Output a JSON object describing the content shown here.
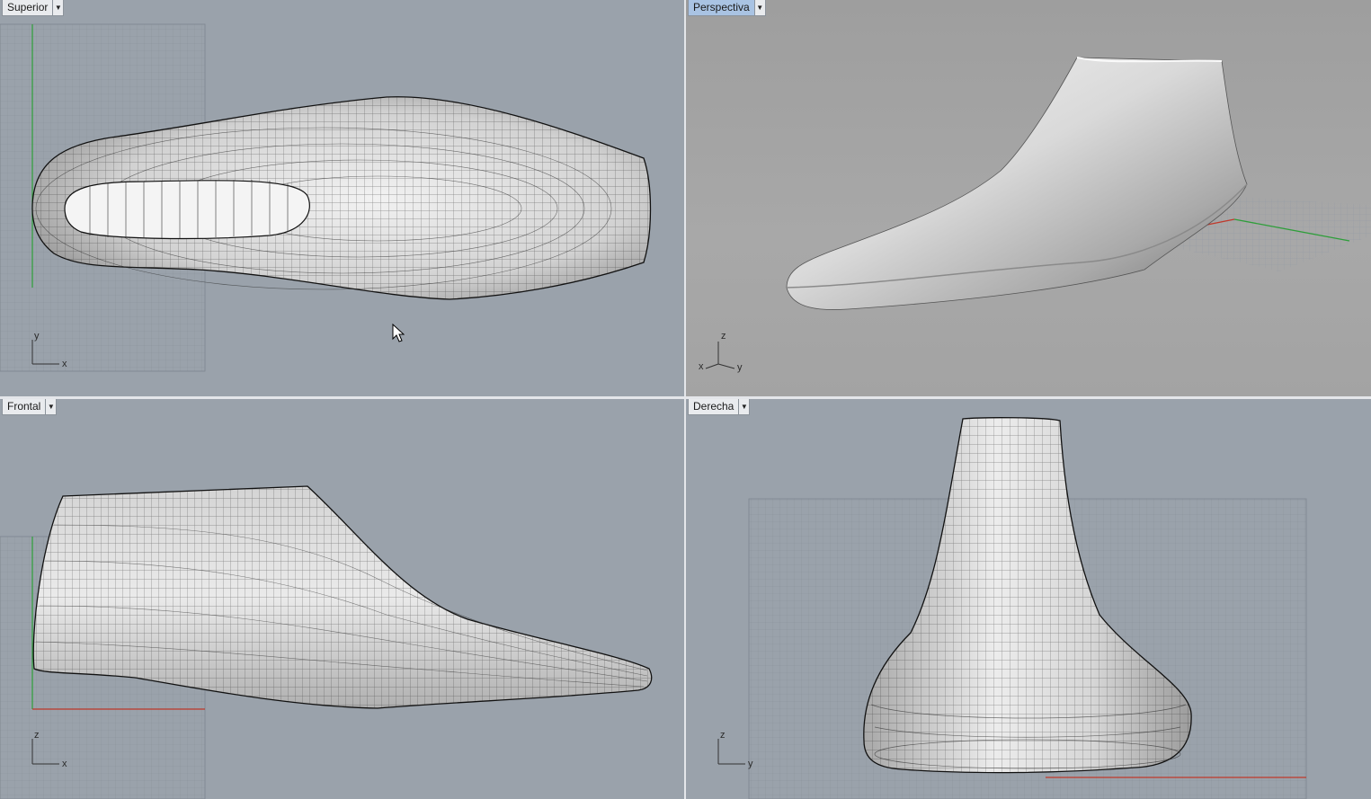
{
  "viewports": {
    "top": {
      "title": "Superior",
      "axis_h": "x",
      "axis_v": "y",
      "icon": "chevron-down-icon"
    },
    "perspective": {
      "title": "Perspectiva",
      "axis_1": "z",
      "axis_2": "x",
      "axis_3": "y",
      "icon": "chevron-down-icon",
      "active": true
    },
    "front": {
      "title": "Frontal",
      "axis_h": "x",
      "axis_v": "z",
      "icon": "chevron-down-icon"
    },
    "right": {
      "title": "Derecha",
      "axis_h": "y",
      "axis_v": "z",
      "icon": "chevron-down-icon"
    }
  },
  "colors": {
    "viewport_bg": "#9aa2ab",
    "grid_line": "#8a929b",
    "x_axis": "#c0392b",
    "y_axis": "#2e9e3a",
    "active_tab": "#a9c3e3"
  },
  "cursor": {
    "icon": "mouse-pointer-icon"
  }
}
